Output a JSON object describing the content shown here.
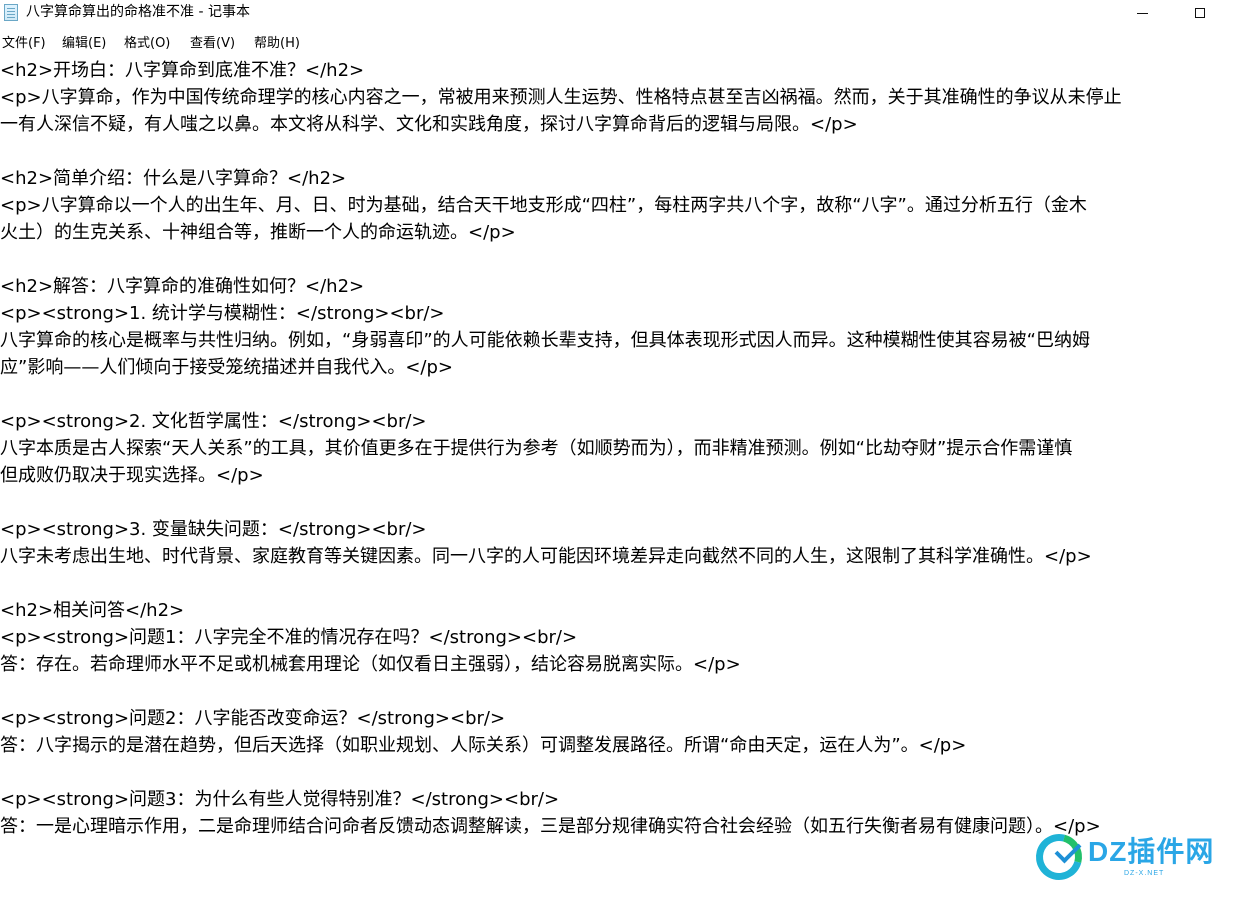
{
  "window": {
    "title": "八字算命算出的命格准不准 - 记事本",
    "icon": "notepad-icon",
    "controls": {
      "minimize": "minimize-icon",
      "maximize": "maximize-icon"
    }
  },
  "menubar": {
    "items": [
      "文件(F)",
      "编辑(E)",
      "格式(O)",
      "查看(V)",
      "帮助(H)"
    ]
  },
  "editor": {
    "lines": [
      "<h2>开场白：八字算命到底准不准？</h2>",
      "<p>八字算命，作为中国传统命理学的核心内容之一，常被用来预测人生运势、性格特点甚至吉凶祸福。然而，关于其准确性的争议从未停止",
      "一有人深信不疑，有人嗤之以鼻。本文将从科学、文化和实践角度，探讨八字算命背后的逻辑与局限。</p>",
      "",
      "<h2>简单介绍：什么是八字算命？</h2>",
      "<p>八字算命以一个人的出生年、月、日、时为基础，结合天干地支形成“四柱”，每柱两字共八个字，故称“八字”。通过分析五行（金木",
      "火土）的生克关系、十神组合等，推断一个人的命运轨迹。</p>",
      "",
      "<h2>解答：八字算命的准确性如何？</h2>",
      "<p><strong>1. 统计学与模糊性：</strong><br/>",
      "八字算命的核心是概率与共性归纳。例如，“身弱喜印”的人可能依赖长辈支持，但具体表现形式因人而异。这种模糊性使其容易被“巴纳姆",
      "应”影响——人们倾向于接受笼统描述并自我代入。</p>",
      "",
      "<p><strong>2. 文化哲学属性：</strong><br/>",
      "八字本质是古人探索“天人关系”的工具，其价值更多在于提供行为参考（如顺势而为），而非精准预测。例如“比劫夺财”提示合作需谨慎",
      "但成败仍取决于现实选择。</p>",
      "",
      "<p><strong>3. 变量缺失问题：</strong><br/>",
      "八字未考虑出生地、时代背景、家庭教育等关键因素。同一八字的人可能因环境差异走向截然不同的人生，这限制了其科学准确性。</p>",
      "",
      "<h2>相关问答</h2>",
      "<p><strong>问题1：八字完全不准的情况存在吗？</strong><br/>",
      "答：存在。若命理师水平不足或机械套用理论（如仅看日主强弱），结论容易脱离实际。</p>",
      "",
      "<p><strong>问题2：八字能否改变命运？</strong><br/>",
      "答：八字揭示的是潜在趋势，但后天选择（如职业规划、人际关系）可调整发展路径。所谓“命由天定，运在人为”。</p>",
      "",
      "<p><strong>问题3：为什么有些人觉得特别准？</strong><br/>",
      "答：一是心理暗示作用，二是命理师结合问命者反馈动态调整解读，三是部分规律确实符合社会经验（如五行失衡者易有健康问题）。</p>"
    ]
  },
  "watermark": {
    "text": "DZ插件网",
    "sub": "DZ-X.NET",
    "logo": "dz-logo-icon",
    "colors": {
      "blue": "#2aa6e6",
      "green": "#22c06b"
    }
  }
}
